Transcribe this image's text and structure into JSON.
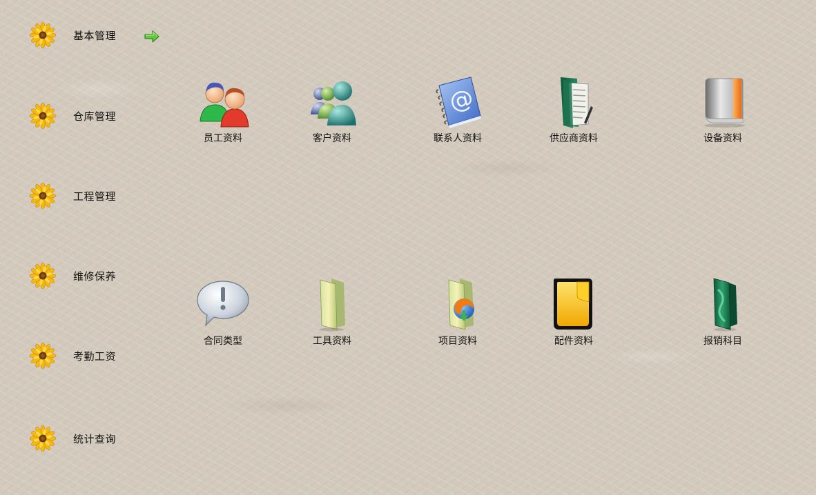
{
  "sidebar": {
    "items": [
      {
        "label": "基本管理",
        "icon": "sunflower-icon",
        "active": true
      },
      {
        "label": "仓库管理",
        "icon": "sunflower-icon"
      },
      {
        "label": "工程管理",
        "icon": "sunflower-icon"
      },
      {
        "label": "维修保养",
        "icon": "sunflower-icon"
      },
      {
        "label": "考勤工资",
        "icon": "sunflower-icon"
      },
      {
        "label": "统计查询",
        "icon": "sunflower-icon"
      }
    ],
    "active_indicator_icon": "green-arrow-right-icon"
  },
  "modules": [
    {
      "label": "员工资料",
      "icon": "employees-icon"
    },
    {
      "label": "客户资料",
      "icon": "customers-icon"
    },
    {
      "label": "联系人资料",
      "icon": "address-book-icon"
    },
    {
      "label": "供应商资料",
      "icon": "document-folder-icon"
    },
    {
      "label": "设备资料",
      "icon": "binder-icon"
    },
    {
      "label": "合同类型",
      "icon": "info-bubble-icon"
    },
    {
      "label": "工具资料",
      "icon": "folder-icon"
    },
    {
      "label": "项目资料",
      "icon": "folder-globe-icon"
    },
    {
      "label": "配件资料",
      "icon": "yellow-folder-icon"
    },
    {
      "label": "报销科目",
      "icon": "green-folder-icon"
    }
  ],
  "colors": {
    "background": "#d3cabd",
    "flower_petal": "#f6c21a",
    "flower_center": "#7a4510",
    "arrow": "#5bc23a"
  }
}
